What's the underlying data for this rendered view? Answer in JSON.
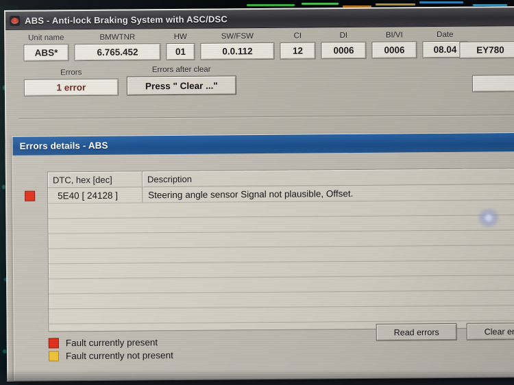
{
  "window": {
    "title": "ABS - Anti-lock Braking System with ASC/DSC",
    "icon": "abs-disc-icon"
  },
  "info_panel": {
    "fields": [
      {
        "label": "Unit name",
        "value": "ABS*"
      },
      {
        "label": "BMWTNR",
        "value": "6.765.452"
      },
      {
        "label": "HW",
        "value": "01"
      },
      {
        "label": "SW/FSW",
        "value": "0.0.112"
      },
      {
        "label": "CI",
        "value": "12"
      },
      {
        "label": "DI",
        "value": "0006"
      },
      {
        "label": "BI/VI",
        "value": "0006"
      },
      {
        "label": "Date",
        "value": "08.04"
      }
    ],
    "clipped_field": {
      "value": "EY780"
    },
    "blank_field": {
      "value": ""
    },
    "errors": {
      "label": "Errors",
      "count_text": "1 error",
      "count_color": "#6d2420"
    },
    "errors_after_clear": {
      "label": "Errors after clear",
      "button_label": "Press \" Clear ...\""
    }
  },
  "errors_window": {
    "title": "Errors details - ABS",
    "title_bar_color": "#1d4f8d",
    "table": {
      "columns": [
        "DTC, hex [dec]",
        "Description"
      ],
      "rows": [
        {
          "marker": "red",
          "dtc": "5E40 [ 24128 ]",
          "description": "Steering angle sensor Signal not plausible, Offset."
        }
      ]
    },
    "legend": [
      {
        "swatch": "red",
        "color": "#e0321c",
        "text": "Fault currently present"
      },
      {
        "swatch": "yellow",
        "color": "#f0c33c",
        "text": "Fault currently not present"
      }
    ],
    "buttons": [
      {
        "label": "Read errors"
      },
      {
        "label": "Clear errors"
      }
    ]
  }
}
